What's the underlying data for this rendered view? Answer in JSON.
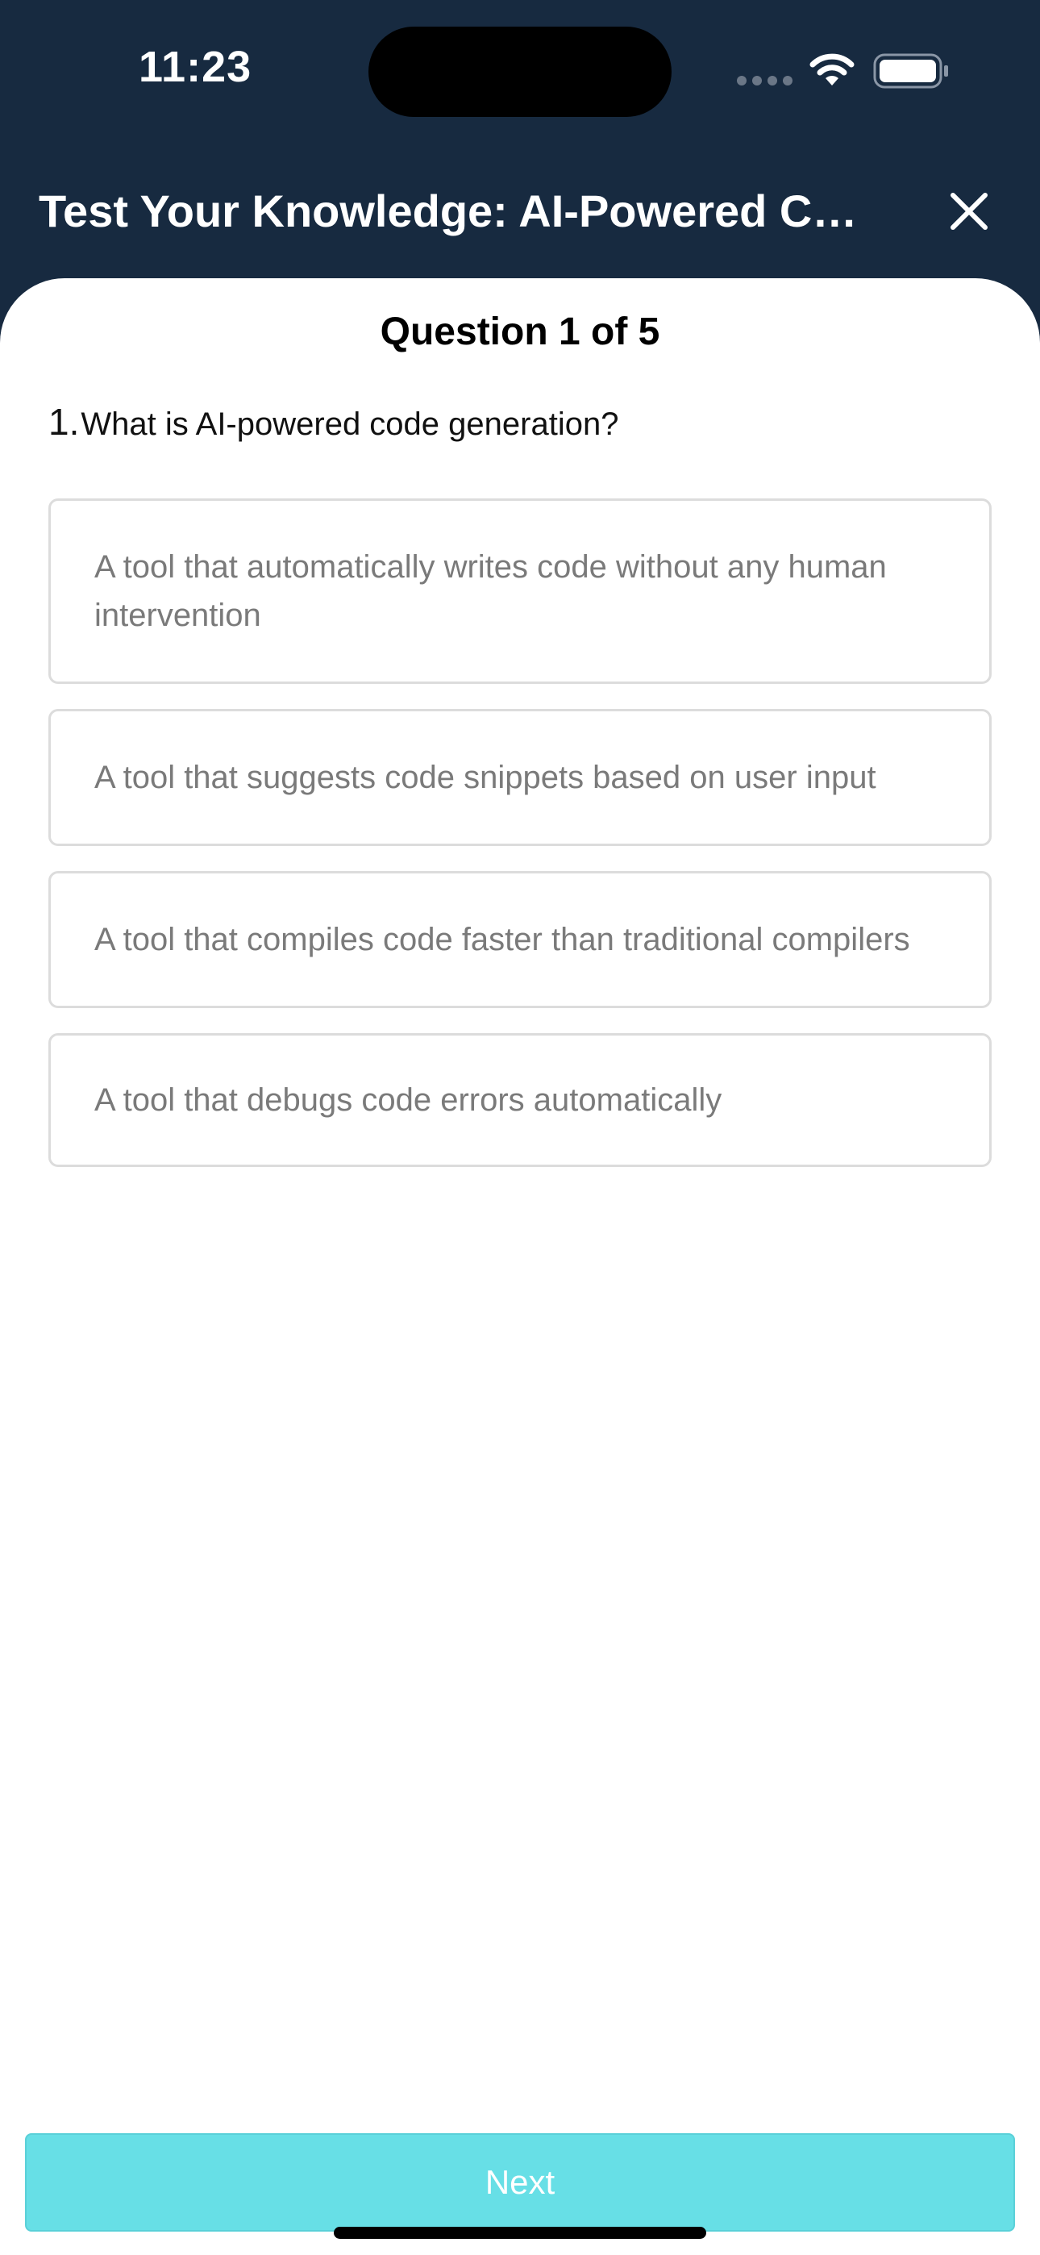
{
  "status_bar": {
    "time": "11:23",
    "icons": [
      "signal-icon",
      "wifi-icon",
      "battery-icon"
    ]
  },
  "header": {
    "title": "Test Your Knowledge: AI-Powered Code Generation",
    "close_icon": "close-icon"
  },
  "quiz": {
    "counter": "Question 1 of 5",
    "question_number": "1.",
    "question": "What is AI-powered code generation?",
    "options": [
      "A tool that automatically writes code without any human intervention",
      "A tool that suggests code snippets based on user input",
      "A tool that compiles code faster than traditional compilers",
      "A tool that debugs code errors automatically"
    ]
  },
  "footer": {
    "next_label": "Next"
  },
  "colors": {
    "header_bg": "#172a40",
    "accent": "#67dfe6",
    "option_border": "#dcdcdc",
    "option_text": "#7a7a7a"
  }
}
